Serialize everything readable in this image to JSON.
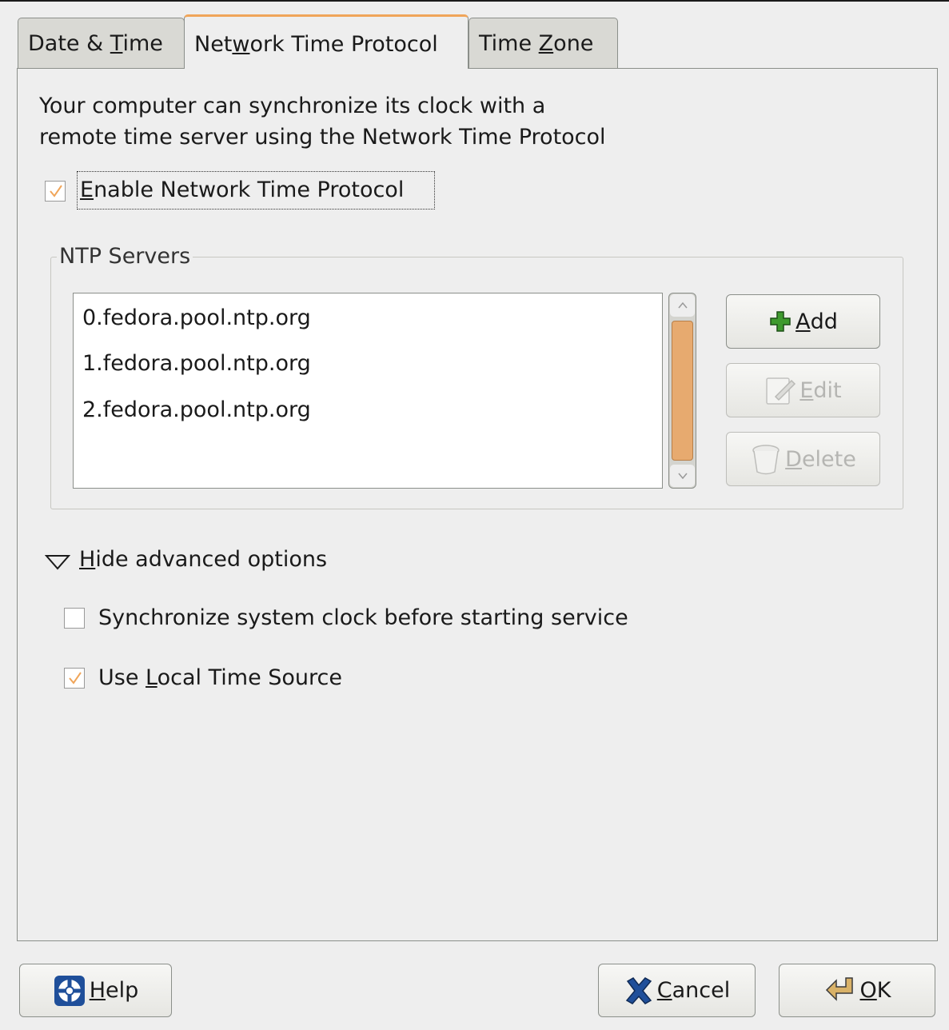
{
  "tabs": [
    {
      "pre": "Date & ",
      "key": "T",
      "post": "ime"
    },
    {
      "pre": "Net",
      "key": "w",
      "post": "ork Time Protocol"
    },
    {
      "pre": "Time ",
      "key": "Z",
      "post": "one"
    }
  ],
  "active_tab": "Network Time Protocol",
  "description": {
    "line1": "Your computer can synchronize its clock with a",
    "line2": "remote time server using the Network Time Protocol"
  },
  "enable_ntp": {
    "key": "E",
    "rest": "nable Network Time Protocol",
    "checked": true
  },
  "ntp_servers": {
    "label": "NTP Servers",
    "servers": [
      "0.fedora.pool.ntp.org",
      "1.fedora.pool.ntp.org",
      "2.fedora.pool.ntp.org"
    ]
  },
  "buttons": {
    "add": {
      "key": "A",
      "rest": "dd",
      "enabled": true
    },
    "edit": {
      "key": "E",
      "rest": "dit",
      "enabled": false
    },
    "delete": {
      "key": "D",
      "rest": "elete",
      "enabled": false
    }
  },
  "advanced": {
    "toggle": {
      "key": "H",
      "rest": "ide advanced options"
    },
    "sync_before_start": {
      "label": "Synchronize system clock before starting service",
      "checked": false
    },
    "local_time_source": {
      "pre": "Use ",
      "key": "L",
      "post": "ocal Time Source",
      "checked": true
    }
  },
  "footer": {
    "help": {
      "key": "H",
      "rest": "elp"
    },
    "cancel": {
      "key": "C",
      "rest": "ancel"
    },
    "ok": {
      "key": "O",
      "rest": "K"
    }
  },
  "colors": {
    "accent": "#f0a559",
    "scroll_thumb": "#e7aa6f",
    "add_icon": "#3f9a2e",
    "cancel_icon": "#1f4f9a"
  }
}
